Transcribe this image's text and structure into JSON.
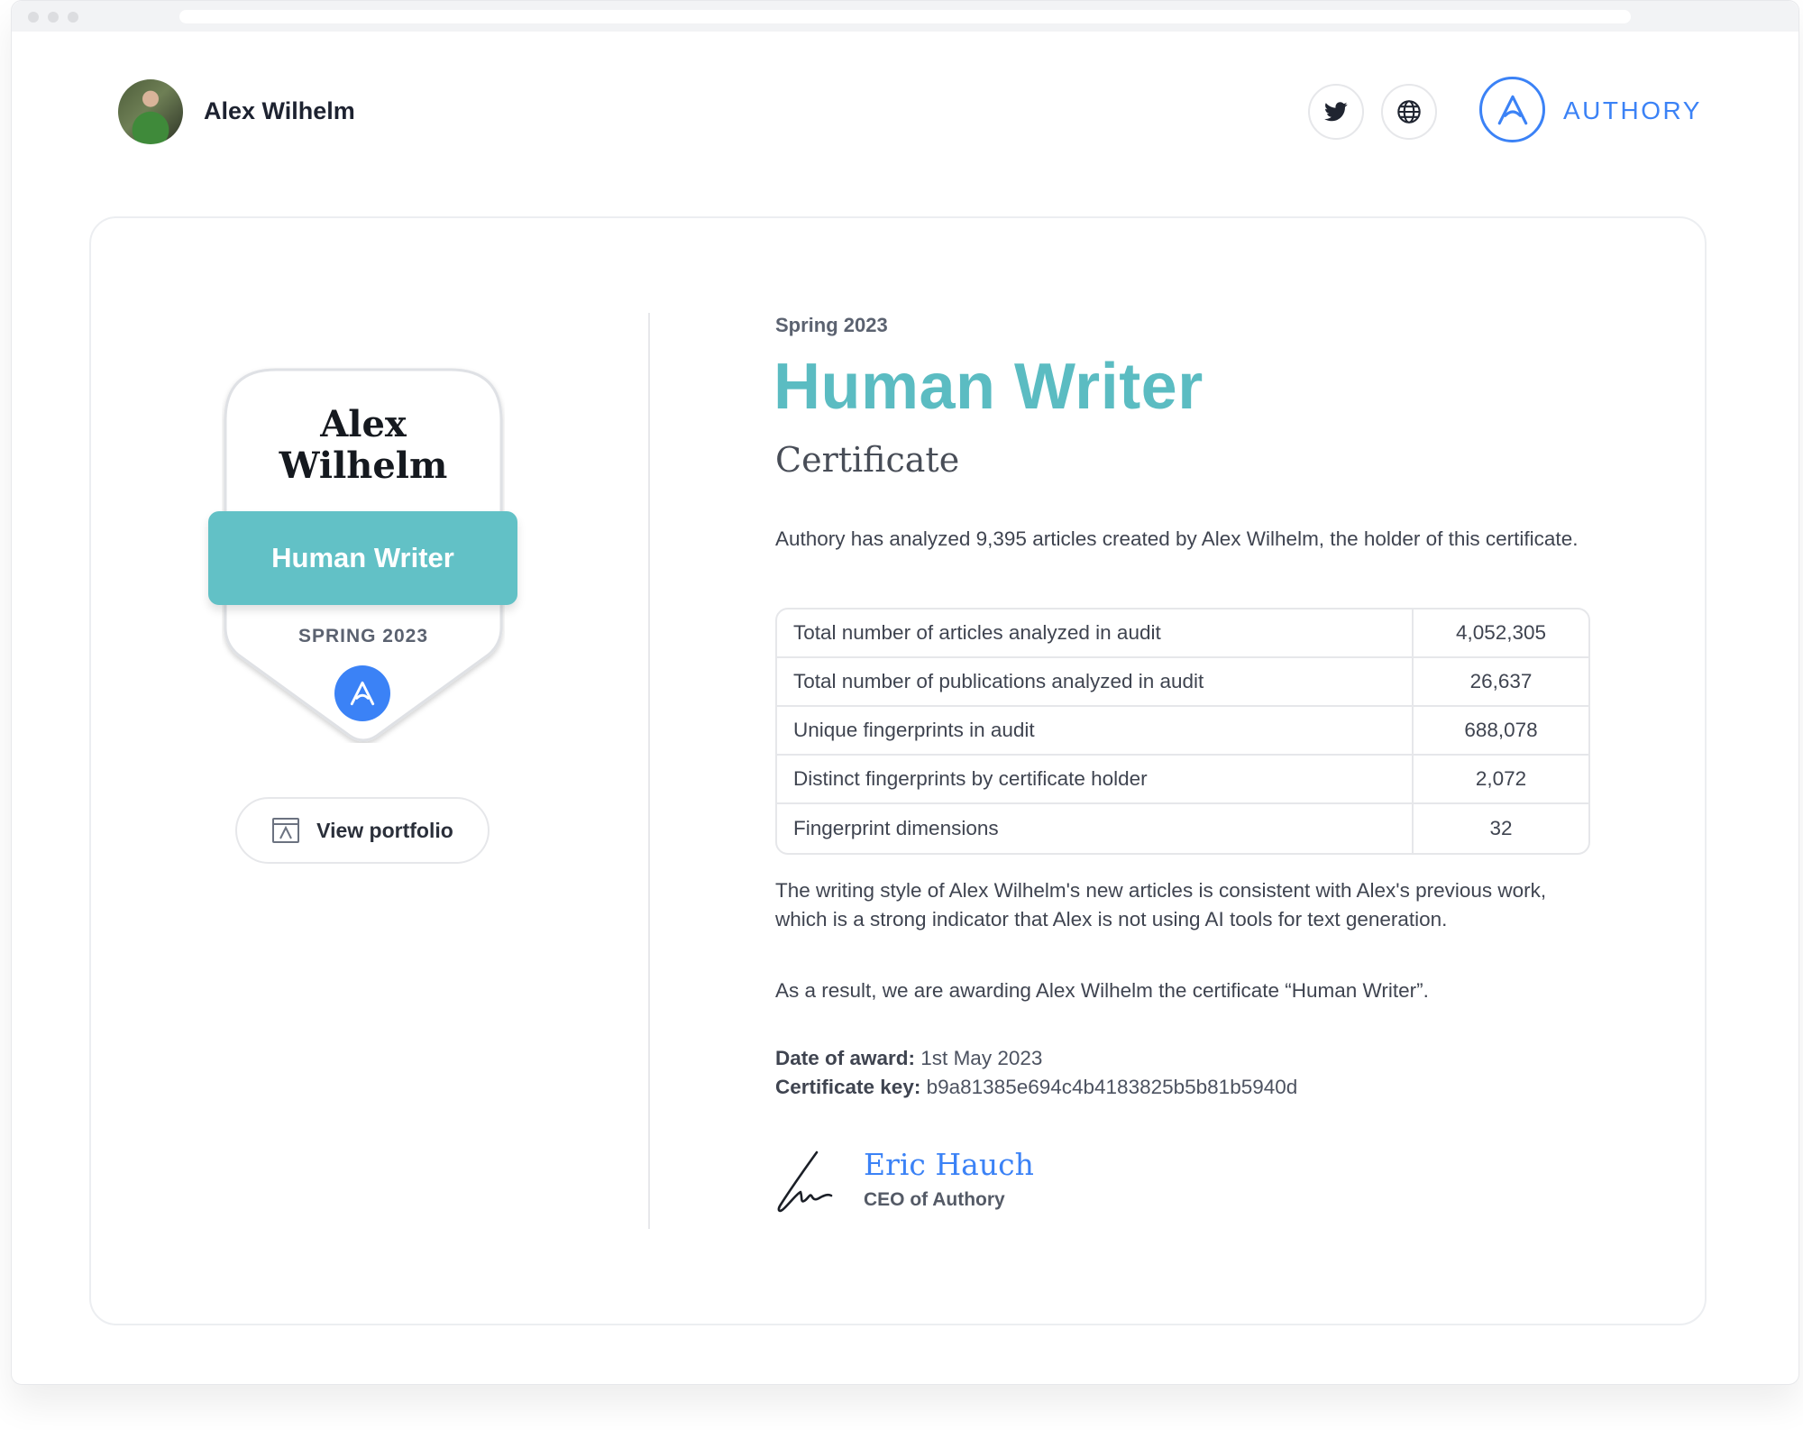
{
  "header": {
    "author_name": "Alex Wilhelm",
    "social_icons": [
      "twitter-icon",
      "globe-icon"
    ],
    "brand": "AUTHORY"
  },
  "badge": {
    "name_line1": "Alex",
    "name_line2": "Wilhelm",
    "title": "Human Writer",
    "season": "SPRING 2023",
    "portfolio_button": "View portfolio"
  },
  "certificate": {
    "season": "Spring 2023",
    "title": "Human Writer",
    "subtitle": "Certificate",
    "intro": "Authory has analyzed 9,395 articles created by Alex Wilhelm, the holder of this certificate.",
    "stats": [
      {
        "label": "Total number of articles analyzed in audit",
        "value": "4,052,305"
      },
      {
        "label": "Total number of publications analyzed in audit",
        "value": "26,637"
      },
      {
        "label": "Unique fingerprints in audit",
        "value": "688,078"
      },
      {
        "label": "Distinct fingerprints by certificate holder",
        "value": "2,072"
      },
      {
        "label": "Fingerprint dimensions",
        "value": "32"
      }
    ],
    "consistency_text": "The writing style of Alex Wilhelm's new articles is consistent with Alex's previous work, which is a strong indicator that Alex is not using AI tools for text generation.",
    "result_text": "As a result, we are awarding Alex Wilhelm the certificate “Human Writer”.",
    "date_label": "Date of award:",
    "date_value": "1st May 2023",
    "key_label": "Certificate key:",
    "key_value": "b9a81385e694c4b4183825b5b81b5940d",
    "signer_name": "Eric Hauch",
    "signer_title": "CEO of Authory"
  },
  "colors": {
    "accent_teal": "#5bbcc2",
    "brand_blue": "#3b82f6"
  }
}
